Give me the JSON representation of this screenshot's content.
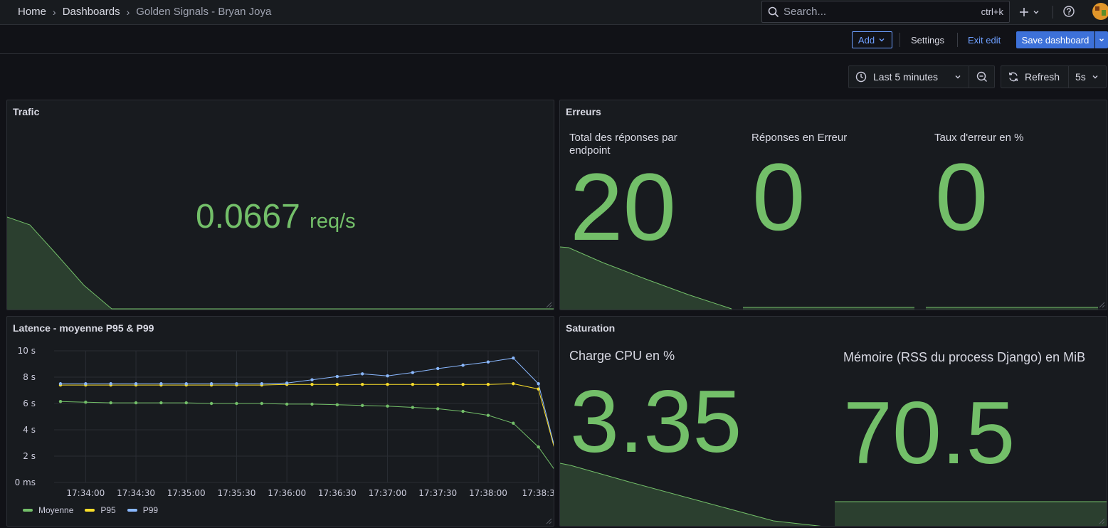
{
  "breadcrumbs": [
    "Home",
    "Dashboards",
    "Golden Signals - Bryan Joya"
  ],
  "search": {
    "placeholder": "Search...",
    "shortcut": "ctrl+k"
  },
  "toolbar": {
    "add": "Add",
    "settings": "Settings",
    "exit_edit": "Exit edit",
    "save": "Save dashboard"
  },
  "time": {
    "range": "Last 5 minutes",
    "refresh": "Refresh",
    "interval": "5s"
  },
  "icons": [
    "search-icon",
    "plus-icon",
    "help-icon",
    "clock-icon",
    "zoom-out-icon",
    "refresh-icon",
    "chevron-down-icon"
  ],
  "colors": {
    "stat_green": "#73bf69",
    "p95_yellow": "#fade2a",
    "p99_blue": "#8ab8ff",
    "accent": "#3d71d9"
  },
  "panels": {
    "trafic": {
      "title": "Trafic",
      "value": "0.0667",
      "unit": "req/s"
    },
    "erreurs": {
      "title": "Erreurs",
      "stats": [
        {
          "title": "Total des réponses par endpoint",
          "value": "20"
        },
        {
          "title": "Réponses en Erreur",
          "value": "0"
        },
        {
          "title": "Taux d'erreur en %",
          "value": "0"
        }
      ]
    },
    "saturation": {
      "title": "Saturation",
      "stats": [
        {
          "title": "Charge CPU en %",
          "value": "3.35"
        },
        {
          "title": "Mémoire (RSS du process Django) en MiB",
          "value": "70.5"
        }
      ]
    },
    "latence": {
      "title": "Latence - moyenne P95 & P99"
    }
  },
  "chart_data": {
    "type": "line",
    "title": "Latence - moyenne P95 & P99",
    "x_ticks": [
      "17:34:00",
      "17:34:30",
      "17:35:00",
      "17:35:30",
      "17:36:00",
      "17:36:30",
      "17:37:00",
      "17:37:30",
      "17:38:00",
      "17:38:3"
    ],
    "y_ticks": [
      "0 ms",
      "2 s",
      "4 s",
      "6 s",
      "8 s",
      "10 s"
    ],
    "ylim": [
      0,
      10
    ],
    "x": [
      "17:33:45",
      "17:34:00",
      "17:34:15",
      "17:34:30",
      "17:34:45",
      "17:35:00",
      "17:35:15",
      "17:35:30",
      "17:35:45",
      "17:36:00",
      "17:36:15",
      "17:36:30",
      "17:36:45",
      "17:37:00",
      "17:37:15",
      "17:37:30",
      "17:37:45",
      "17:38:00",
      "17:38:15",
      "17:38:30"
    ],
    "series": [
      {
        "name": "Moyenne",
        "color": "#73bf69",
        "values": [
          6.15,
          6.1,
          6.05,
          6.05,
          6.05,
          6.05,
          6.0,
          6.0,
          6.0,
          5.95,
          5.95,
          5.9,
          5.85,
          5.8,
          5.7,
          5.6,
          5.4,
          5.1,
          4.5,
          2.7,
          0.0
        ]
      },
      {
        "name": "P95",
        "color": "#fade2a",
        "values": [
          7.4,
          7.4,
          7.4,
          7.4,
          7.4,
          7.4,
          7.4,
          7.4,
          7.4,
          7.45,
          7.45,
          7.45,
          7.45,
          7.45,
          7.45,
          7.45,
          7.45,
          7.45,
          7.5,
          7.1,
          0.0
        ]
      },
      {
        "name": "P99",
        "color": "#8ab8ff",
        "values": [
          7.5,
          7.5,
          7.5,
          7.5,
          7.5,
          7.5,
          7.5,
          7.5,
          7.5,
          7.55,
          7.8,
          8.05,
          8.25,
          8.1,
          8.35,
          8.65,
          8.9,
          9.15,
          9.45,
          7.5,
          0.0
        ]
      }
    ],
    "legend_position": "bottom-left",
    "grid": true
  }
}
